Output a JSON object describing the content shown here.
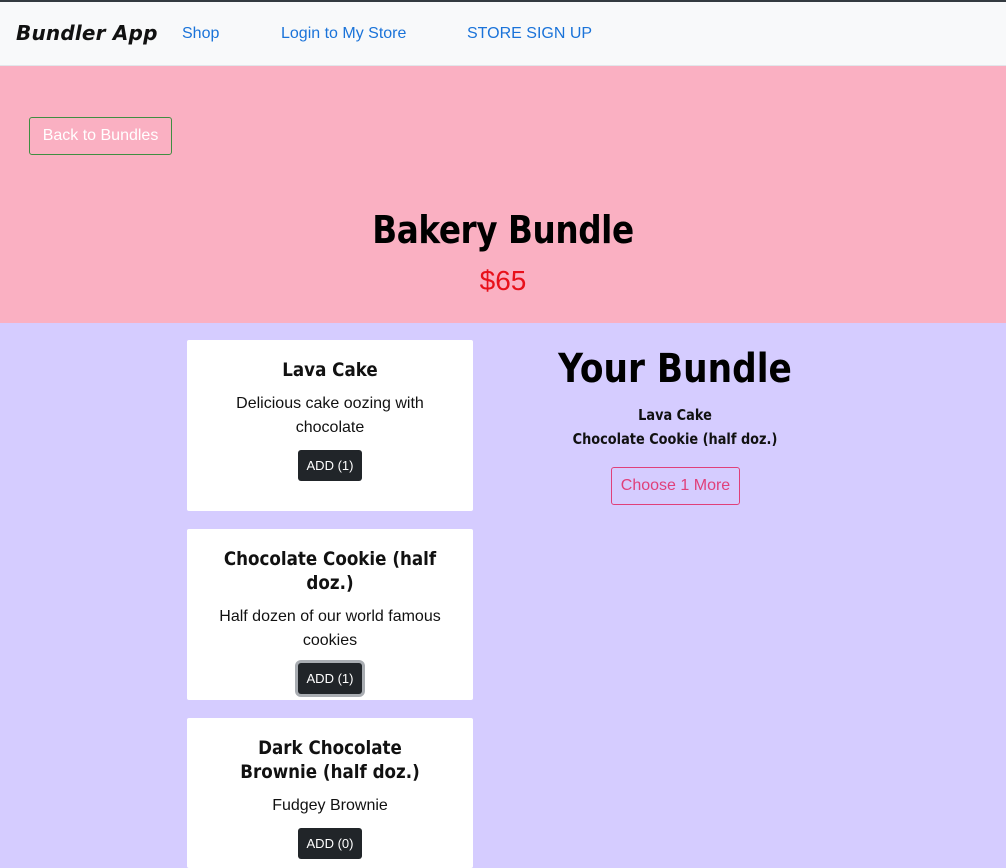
{
  "navbar": {
    "brand": "Bundler App",
    "links": [
      {
        "label": "Shop"
      },
      {
        "label": "Login to My Store"
      },
      {
        "label": "STORE SIGN UP"
      }
    ]
  },
  "hero": {
    "back_label": "Back to Bundles",
    "title": "Bakery Bundle",
    "price": "$65",
    "background": "#fab0c2",
    "price_color": "#e8101a"
  },
  "products": [
    {
      "name": "Lava Cake",
      "description": "Delicious cake oozing with chocolate",
      "button_label": "ADD (1)"
    },
    {
      "name": "Chocolate Cookie (half doz.)",
      "description": "Half dozen of our world famous cookies",
      "button_label": "ADD (1)"
    },
    {
      "name": "Dark Chocolate Brownie (half doz.)",
      "description": "Fudgey Brownie",
      "button_label": "ADD (0)"
    }
  ],
  "your_bundle": {
    "title": "Your Bundle",
    "items": [
      "Lava Cake",
      "Chocolate Cookie (half doz.)"
    ],
    "choose_label": "Choose 1 More"
  },
  "colors": {
    "page_background": "#d5ccff",
    "nav_link": "#1a73d9",
    "choose_accent": "#e0407a",
    "add_button": "#212529"
  }
}
